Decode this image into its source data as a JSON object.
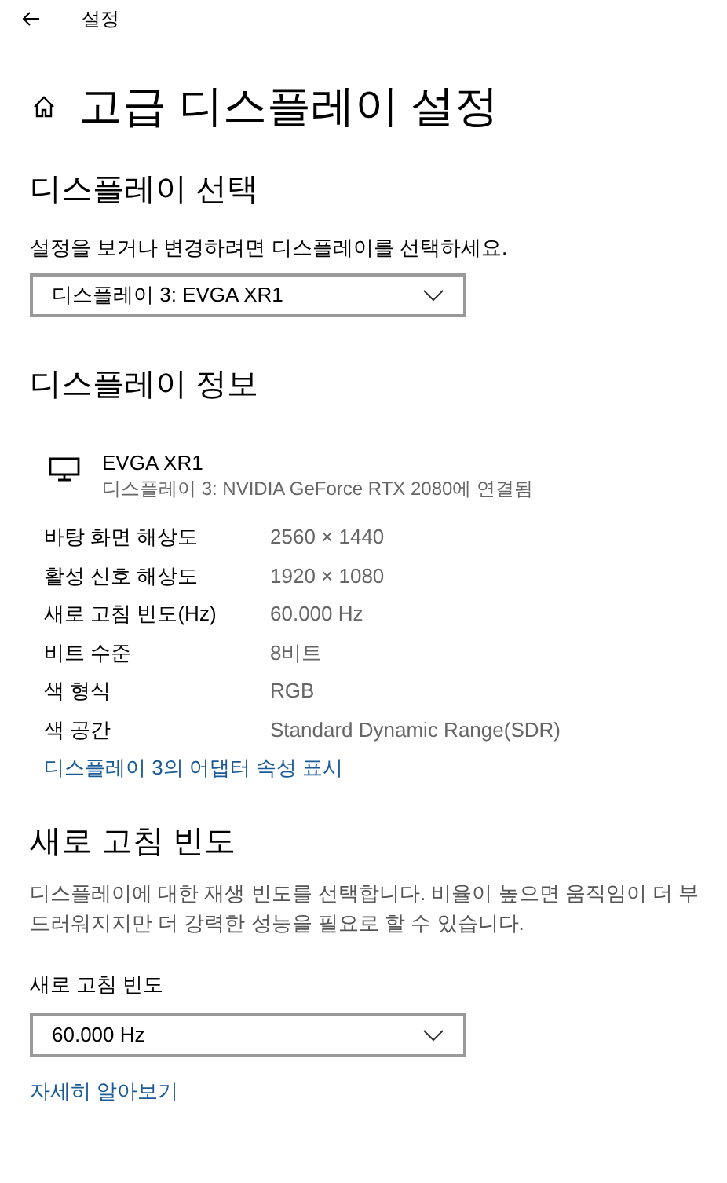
{
  "window": {
    "title": "설정"
  },
  "page_title": "고급 디스플레이 설정",
  "display_select": {
    "heading": "디스플레이 선택",
    "description": "설정을 보거나 변경하려면 디스플레이를 선택하세요.",
    "dropdown": {
      "value": "디스플레이 3: EVGA XR1"
    }
  },
  "display_info": {
    "heading": "디스플레이 정보",
    "monitor": {
      "name": "EVGA XR1",
      "subtitle": "디스플레이 3: NVIDIA GeForce RTX 2080에 연결됨"
    },
    "rows": [
      {
        "label": "바탕 화면 해상도",
        "value": "2560 × 1440"
      },
      {
        "label": "활성 신호 해상도",
        "value": "1920 × 1080"
      },
      {
        "label": "새로 고침 빈도(Hz)",
        "value": "60.000 Hz"
      },
      {
        "label": "비트 수준",
        "value": "8비트"
      },
      {
        "label": "색 형식",
        "value": "RGB"
      },
      {
        "label": "색 공간",
        "value": "Standard Dynamic Range(SDR)"
      }
    ],
    "link": "디스플레이 3의 어댑터 속성 표시"
  },
  "refresh_rate": {
    "heading": "새로 고침 빈도",
    "description": "디스플레이에 대한 재생 빈도를 선택합니다. 비율이 높으면 움직임이 더 부드러워지지만 더 강력한 성능을 필요로 할 수 있습니다.",
    "label": "새로 고침 빈도",
    "dropdown": {
      "value": "60.000 Hz"
    },
    "link": "자세히 알아보기"
  }
}
